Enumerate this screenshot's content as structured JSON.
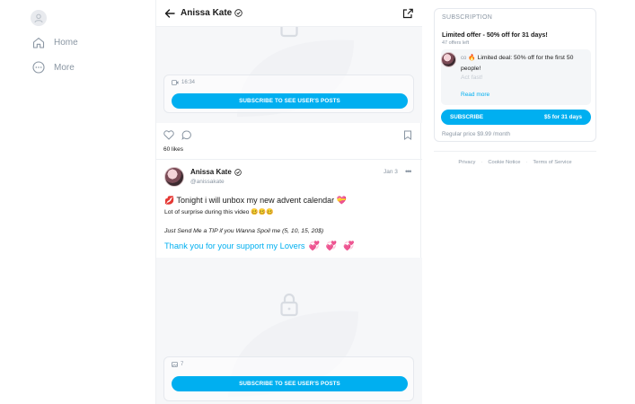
{
  "nav": {
    "items": [
      {
        "label": "Home",
        "icon": "home-icon"
      },
      {
        "label": "More",
        "icon": "more-circle-icon"
      }
    ]
  },
  "header": {
    "title": "Anissa Kate"
  },
  "locked_post_1": {
    "meta": "16:34",
    "subscribe_label": "SUBSCRIBE TO SEE USER'S POSTS"
  },
  "actions": {
    "likes": "60 likes"
  },
  "post": {
    "name": "Anissa Kate",
    "handle": "@anissakate",
    "date": "Jan 3",
    "more": "•••",
    "line1_lead": "💋",
    "line1": " Tonight i will unbox my new advent calendar ",
    "line1_trail": "💝",
    "line2": "Lot of surprise during this video 🥴🥴🥴",
    "line3": "Just Send Me a TIP if you Wanna Spoil me (5, 10, 15, 20$)",
    "line4": "Thank you for your support my Lovers",
    "hearts": "💞 💞 💞"
  },
  "locked_post_2": {
    "meta": "7",
    "subscribe_label": "SUBSCRIBE TO SEE USER'S POSTS"
  },
  "sidebar": {
    "heading": "SUBSCRIPTION",
    "offer_title": "Limited offer - 50% off for 31 days!",
    "offers_left": "47 offers left",
    "card_user": "co",
    "card_message": "🔥 Limited deal: 50% off for the first 50 people!",
    "card_faded": "Act fast!",
    "read_more": "Read more",
    "btn_left": "SUBSCRIBE",
    "btn_right": "$5 for 31 days",
    "regular_price": "Regular price $9.99 /month"
  },
  "footer": {
    "links": [
      "Privacy",
      "Cookie Notice",
      "Terms of Service"
    ]
  },
  "colors": {
    "accent": "#00aff0",
    "muted": "#8a96a3",
    "locked_bg": "#f6f7f9"
  }
}
